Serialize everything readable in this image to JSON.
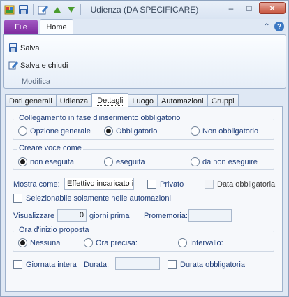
{
  "window": {
    "title": "Udienza (DA SPECIFICARE)"
  },
  "qat": {
    "icons": [
      "app-icon",
      "save-icon",
      "edit-icon",
      "arrow-up-icon",
      "arrow-down-icon"
    ]
  },
  "ribbon": {
    "tabs": {
      "file": "File",
      "home": "Home"
    },
    "actions": {
      "save": "Salva",
      "save_close": "Salva e chiudi"
    },
    "group_label": "Modifica"
  },
  "tabs": [
    "Dati generali",
    "Udienza",
    "Dettagli",
    "Luogo",
    "Automazioni",
    "Gruppi"
  ],
  "active_tab": "Dettagli",
  "collegamento": {
    "title": "Collegamento in fase d'inserimento obbligatorio",
    "options": [
      "Opzione generale",
      "Obbligatorio",
      "Non obbligatorio"
    ],
    "selected": "Obbligatorio"
  },
  "creare": {
    "title": "Creare voce come",
    "options": [
      "non eseguita",
      "eseguita",
      "da non eseguire"
    ],
    "selected": "non eseguita"
  },
  "mostra": {
    "label": "Mostra come:",
    "value": "Effettivo incaricato ir"
  },
  "privato": {
    "label": "Privato",
    "checked": false
  },
  "data_obbligatoria": {
    "label": "Data obbligatoria",
    "checked": false,
    "enabled": false
  },
  "selezionabile": {
    "label": "Selezionabile solamente nelle automazioni",
    "checked": false
  },
  "visualizzare": {
    "label": "Visualizzare",
    "value": "0",
    "suffix": "giorni prima"
  },
  "promemoria": {
    "label": "Promemoria:",
    "value": ""
  },
  "ora": {
    "title": "Ora d'inizio proposta",
    "options": [
      "Nessuna",
      "Ora precisa:",
      "Intervallo:"
    ],
    "selected": "Nessuna"
  },
  "giornata": {
    "label": "Giornata intera",
    "checked": false
  },
  "durata": {
    "label": "Durata:",
    "value": ""
  },
  "durata_obbligatoria": {
    "label": "Durata obbligatoria",
    "checked": false
  }
}
